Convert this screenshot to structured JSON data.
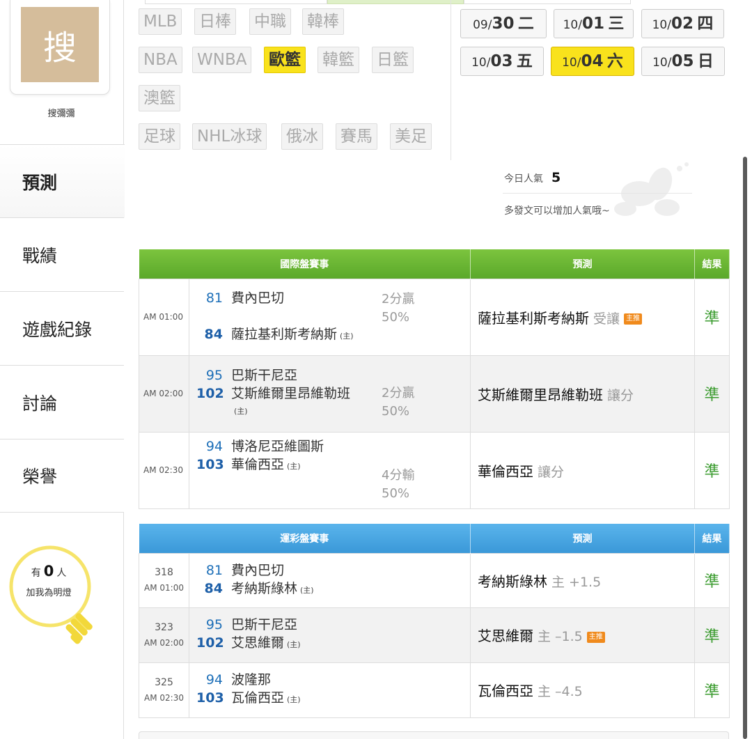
{
  "sidebar": {
    "avatar_char": "搜",
    "username": "搜彌彌",
    "nav": [
      {
        "label": "預測",
        "active": true
      },
      {
        "label": "戰績"
      },
      {
        "label": "遊戲紀錄"
      },
      {
        "label": "討論"
      },
      {
        "label": "榮譽"
      }
    ],
    "fans_prefix": "有",
    "fans_count": "0",
    "fans_suffix": "人",
    "fans_note": "加我為明燈"
  },
  "leagues": [
    "MLB",
    "日棒",
    "中職",
    "韓棒",
    "NBA",
    "WNBA",
    "歐籃",
    "韓籃",
    "日籃",
    "澳籃",
    "足球",
    "NHL冰球",
    "俄冰",
    "賽馬",
    "美足"
  ],
  "active_league": "歐籃",
  "dates": [
    {
      "prefix": "09/",
      "day": "30",
      "weekday": "二"
    },
    {
      "prefix": "10/",
      "day": "01",
      "weekday": "三"
    },
    {
      "prefix": "10/",
      "day": "02",
      "weekday": "四"
    },
    {
      "prefix": "10/",
      "day": "03",
      "weekday": "五"
    },
    {
      "prefix": "10/",
      "day": "04",
      "weekday": "六",
      "active": true
    },
    {
      "prefix": "10/",
      "day": "05",
      "weekday": "日"
    }
  ],
  "popularity": {
    "label": "今日人氣",
    "value": "5",
    "hint": "多發文可以增加人氣哦~"
  },
  "international": {
    "headers": [
      "國際盤賽事",
      "預測",
      "結果"
    ],
    "rows": [
      {
        "time": "AM 01:00",
        "away_score": "81",
        "away": "費內巴切",
        "home_score": "84",
        "home": "薩拉基利斯考納斯",
        "home_tag": "(主)",
        "odds1": "2分贏",
        "odds2": "50%",
        "pick": "薩拉基利斯考納斯",
        "pick_type": "受讓",
        "badge": "主推",
        "result": "準"
      },
      {
        "time": "AM 02:00",
        "away_score": "95",
        "away": "巴斯干尼亞",
        "home_score": "102",
        "home": "艾斯維爾里昂維勒班",
        "home_tag": "(主)",
        "odds1": "2分贏",
        "odds2": "50%",
        "pick": "艾斯維爾里昂維勒班",
        "pick_type": "讓分",
        "badge": "",
        "result": "準"
      },
      {
        "time": "AM 02:30",
        "away_score": "94",
        "away": "博洛尼亞維圖斯",
        "home_score": "103",
        "home": "華倫西亞",
        "home_tag": "(主)",
        "odds1": "4分輸",
        "odds2": "50%",
        "pick": "華倫西亞",
        "pick_type": "讓分",
        "badge": "",
        "result": "準"
      }
    ]
  },
  "sportslottery": {
    "headers": [
      "運彩盤賽事",
      "預測",
      "結果"
    ],
    "rows": [
      {
        "num": "318",
        "time": "AM 01:00",
        "away_score": "81",
        "away": "費內巴切",
        "home_score": "84",
        "home": "考納斯綠林",
        "home_tag": "(主)",
        "pick": "考納斯綠林",
        "pick_type": "主 +1.5",
        "badge": "",
        "result": "準"
      },
      {
        "num": "323",
        "time": "AM 02:00",
        "away_score": "95",
        "away": "巴斯干尼亞",
        "home_score": "102",
        "home": "艾思維爾",
        "home_tag": "(主)",
        "pick": "艾思維爾",
        "pick_type": "主 –1.5",
        "badge": "主推",
        "result": "準"
      },
      {
        "num": "325",
        "time": "AM 02:30",
        "away_score": "94",
        "away": "波隆那",
        "home_score": "103",
        "home": "瓦倫西亞",
        "home_tag": "(主)",
        "pick": "瓦倫西亞",
        "pick_type": "主 –4.5",
        "badge": "",
        "result": "準"
      }
    ]
  },
  "colors": {
    "accent_yellow": "#f9e21c",
    "international_header": "#5aa82a",
    "sportslottery_header": "#3a98d8",
    "result_green": "#3a9b2e",
    "score_blue": "#1d6fb8"
  }
}
